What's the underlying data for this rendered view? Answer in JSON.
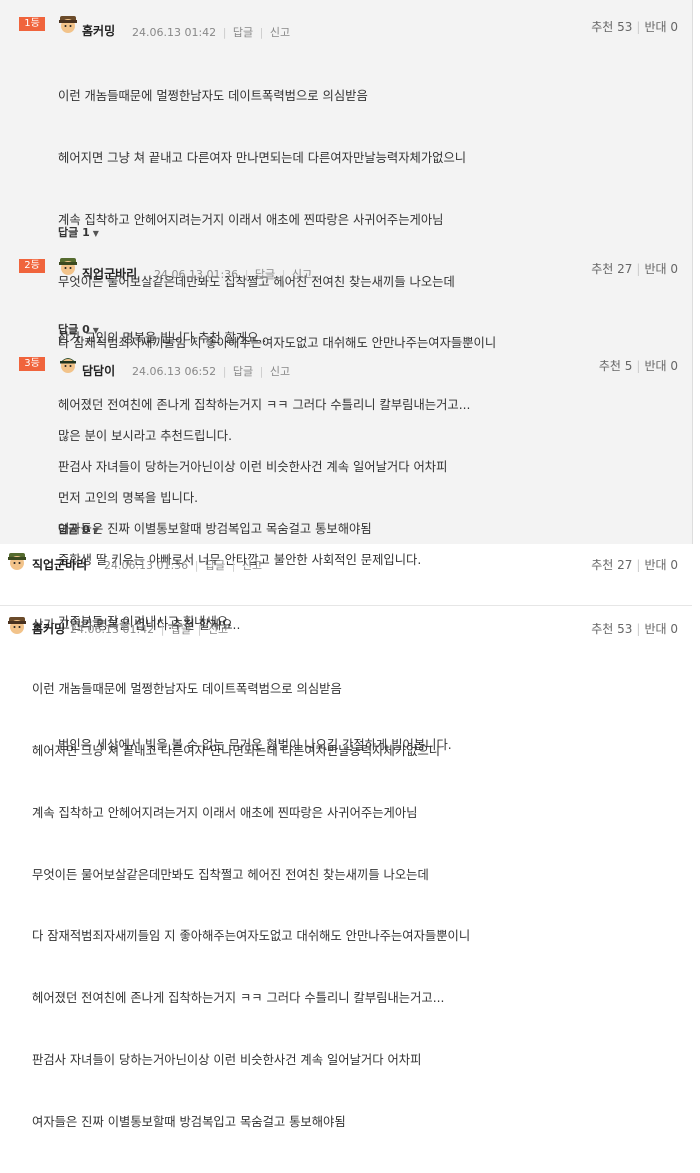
{
  "best_comments": [
    {
      "rank": "1등",
      "nick": "홈커밍",
      "date": "24.06.13 01:42",
      "reply_action": "답글",
      "report_action": "신고",
      "recommend": "추천 53",
      "oppose": "반대 0",
      "lines": [
        "이런 개놈들때문에 멀쩡한남자도 데이트폭력범으로 의심받음",
        "헤어지면 그냥 쳐 끝내고 다른여자 만나면되는데 다른여자만날능력자체가없으니",
        "계속 집착하고 안헤어지려는거지 이래서 애초에 찐따랑은 사귀어주는게아님",
        "무엇이든 물어보살같은데만봐도 집착쩔고 헤어진 전여친 찾는새끼들 나오는데",
        "다 잠재적범죄자새끼들임 지 좋아해주는여자도없고 대쉬해도 안만나주는여자들뿐이니",
        "헤어졌던 전여친에 존나게 집착하는거지 ㅋㅋ 그러다 수틀리니 칼부림내는거고...",
        "판검사 자녀들이 당하는거아닌이상 이런 비슷한사건 계속 일어날거다 어차피",
        "여자들은 진짜 이별통보할때 방검복입고 목숨걸고 통보해야됨"
      ],
      "replies": "답글 1"
    },
    {
      "rank": "2등",
      "nick": "직업군바리",
      "date": "24.06.13 01:36",
      "reply_action": "답글",
      "report_action": "신고",
      "recommend": "추천 27",
      "oppose": "반대 0",
      "lines": [
        "삼가 고인의 명복을 빕니다.추천 할게요.."
      ],
      "replies": "답글 0"
    },
    {
      "rank": "3등",
      "nick": "담담이",
      "date": "24.06.13 06:52",
      "reply_action": "답글",
      "report_action": "신고",
      "recommend": "추천 5",
      "oppose": "반대 0",
      "lines": [
        "많은 분이 보시라고 추천드립니다.",
        "먼저 고인의 명복을 빕니다.",
        "중학생 딸 키우는 아빠로서 너무 안타깝고 불안한 사회적인 문제입니다.",
        "가족분들 잘 이겨내시고 힘내세요.",
        "",
        "범인은 세상에서 빛을 볼 수 없는 무거운 형벌이 나오길 간절하게 빌어봅니다."
      ],
      "replies": "답글 0"
    }
  ],
  "comments": [
    {
      "nick": "직업군바리",
      "date": "24.06.13 01:36",
      "reply_action": "답글",
      "report_action": "신고",
      "recommend": "추천 27",
      "oppose": "반대 0",
      "lines": [
        "삼가 고인의 명복을 빕니다.추천 할게요.."
      ]
    },
    {
      "nick": "홈커밍",
      "date": "24.06.13 01:42",
      "reply_action": "답글",
      "report_action": "신고",
      "recommend": "추천 53",
      "oppose": "반대 0",
      "lines": [
        "이런 개놈들때문에 멀쩡한남자도 데이트폭력범으로 의심받음",
        "헤어지면 그냥 쳐 끝내고 다른여자 만나면되는데 다른여자만날능력자체가없으니",
        "계속 집착하고 안헤어지려는거지 이래서 애초에 찐따랑은 사귀어주는게아님",
        "무엇이든 물어보살같은데만봐도 집착쩔고 헤어진 전여친 찾는새끼들 나오는데",
        "다 잠재적범죄자새끼들임 지 좋아해주는여자도없고 대쉬해도 안만나주는여자들뿐이니",
        "헤어졌던 전여친에 존나게 집착하는거지 ㅋㅋ 그러다 수틀리니 칼부림내는거고...",
        "판검사 자녀들이 당하는거아닌이상 이런 비슷한사건 계속 일어날거다 어차피",
        "여자들은 진짜 이별통보할때 방검복입고 목숨걸고 통보해야됨"
      ]
    }
  ],
  "colors": {
    "rank_badge": "#f0643c",
    "best_bg": "#f3f3f3"
  },
  "icons": {
    "avatar": "avatar-icon",
    "chevron": "chevron-down-icon"
  }
}
